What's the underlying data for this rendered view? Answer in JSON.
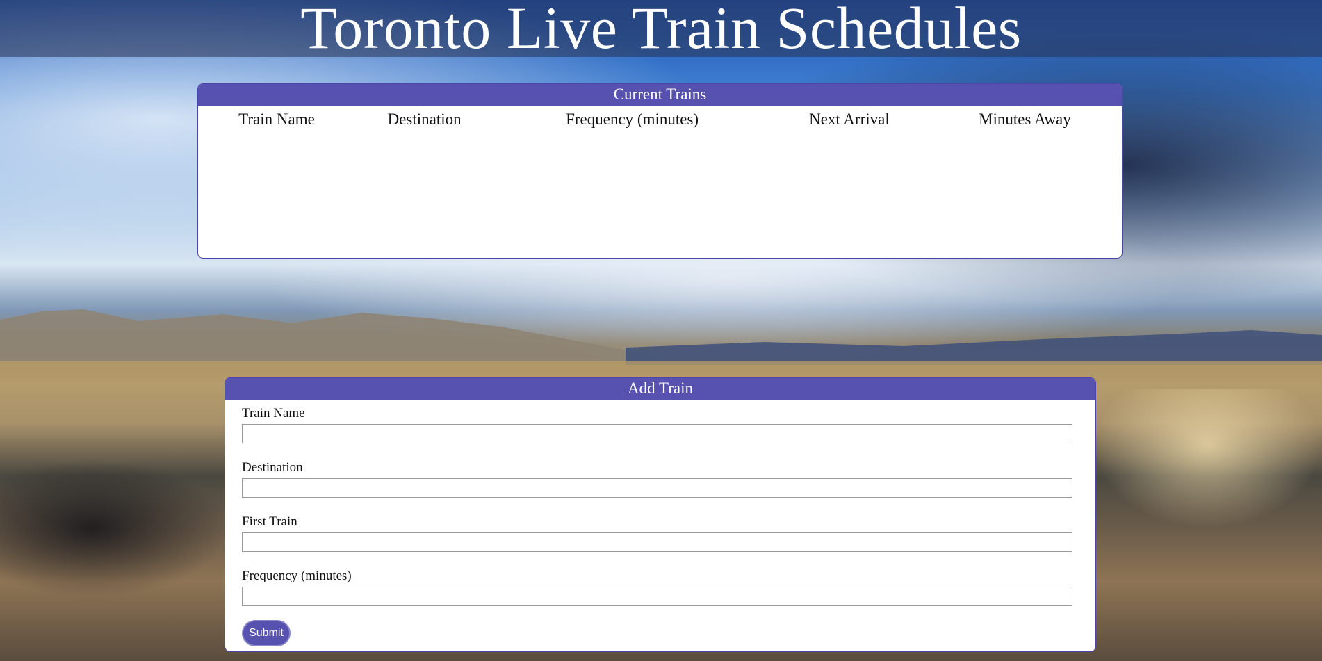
{
  "header": {
    "title": "Toronto Live Train Schedules"
  },
  "current_trains": {
    "heading": "Current Trains",
    "columns": [
      "Train Name",
      "Destination",
      "Frequency (minutes)",
      "Next Arrival",
      "Minutes Away"
    ],
    "rows": []
  },
  "add_train": {
    "heading": "Add Train",
    "fields": [
      {
        "label": "Train Name",
        "value": "",
        "placeholder": ""
      },
      {
        "label": "Destination",
        "value": "",
        "placeholder": ""
      },
      {
        "label": "First Train",
        "value": "",
        "placeholder": ""
      },
      {
        "label": "Frequency (minutes)",
        "value": "",
        "placeholder": ""
      }
    ],
    "submit_label": "Submit"
  },
  "colors": {
    "accent": "#5752b0",
    "panel_background": "#ffffff",
    "heading_text": "#ffffff"
  }
}
